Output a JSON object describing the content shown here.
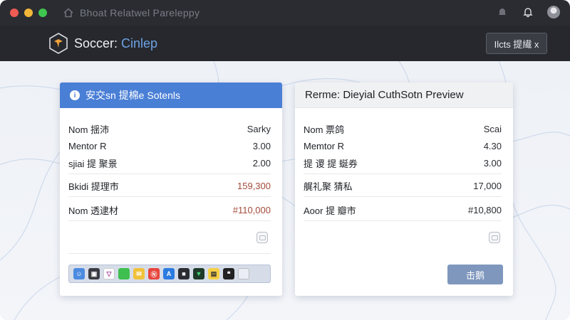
{
  "window": {
    "title": "Bhoat Relatwel Pareleppy"
  },
  "header": {
    "app_title_prefix": "Soccer: ",
    "app_title_accent": "Cinlep",
    "button_label": "Ilcts 提繊 x"
  },
  "left_card": {
    "title": "安交sn 提棉e Sotenls",
    "rows": [
      {
        "label": "Nom 揺沛",
        "value": "Sarky"
      },
      {
        "label": "Mentor R",
        "value": "3.00"
      },
      {
        "label": "sjiai 提 聚景",
        "value": "2.00"
      },
      {
        "label": "Bkidi 提理市",
        "value": "159,300"
      },
      {
        "label": "Nom 透逮材",
        "value": "#110,000"
      }
    ],
    "dock_icons": [
      "finder",
      "terminal",
      "vector",
      "messages",
      "mail",
      "news",
      "appstore",
      "dark",
      "terminal2",
      "notes",
      "quote",
      "preview"
    ]
  },
  "right_card": {
    "title": "Rerme: Dieyial CuthSotn Preview",
    "rows": [
      {
        "label": "Nom 票鸽",
        "value": "Scai"
      },
      {
        "label": "Memtor R",
        "value": "4.30"
      },
      {
        "label": "提 谡 提 蜒券",
        "value": "3.00"
      },
      {
        "label": "艉礼聚 猜私",
        "value": "17,000"
      },
      {
        "label": "Aoor 提 瓣市",
        "value": "#10,800"
      }
    ],
    "button_label": "击鹅"
  },
  "colors": {
    "accent_blue": "#4a7fd6",
    "header_dark": "#26282d",
    "value_red": "#a24b3a",
    "action_button": "#7f97bd"
  }
}
